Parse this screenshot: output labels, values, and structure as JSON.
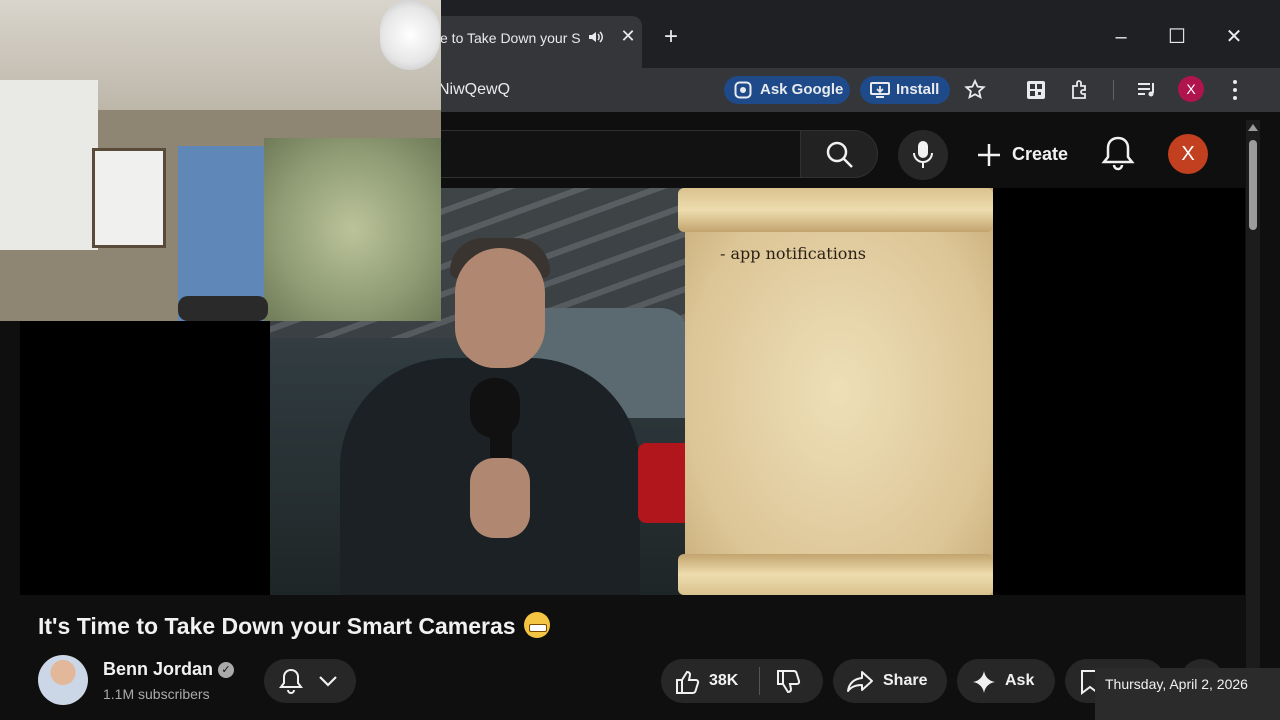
{
  "browser": {
    "tab": {
      "title": "e to Take Down your Sm",
      "audio_icon": "speaker-icon",
      "close_label": "✕"
    },
    "new_tab_label": "+",
    "window_controls": {
      "minimize": "–",
      "maximize": "☐",
      "close": "✕"
    },
    "address": {
      "url_fragment": "NiwQewQ"
    },
    "ask_google_label": "Ask Google",
    "install_label": "Install",
    "profile_letter": "X",
    "accent_color": "#1f4a8a"
  },
  "youtube": {
    "create_label": "Create",
    "account_letter": "X",
    "video": {
      "scroll_text": "- app notifications"
    },
    "title": "It's Time to Take Down your Smart Cameras",
    "channel": {
      "name": "Benn Jordan",
      "subscribers": "1.1M subscribers"
    },
    "actions": {
      "like_count": "38K",
      "share_label": "Share",
      "ask_label": "Ask"
    }
  },
  "system": {
    "date": "Thursday, April 2, 2026"
  }
}
